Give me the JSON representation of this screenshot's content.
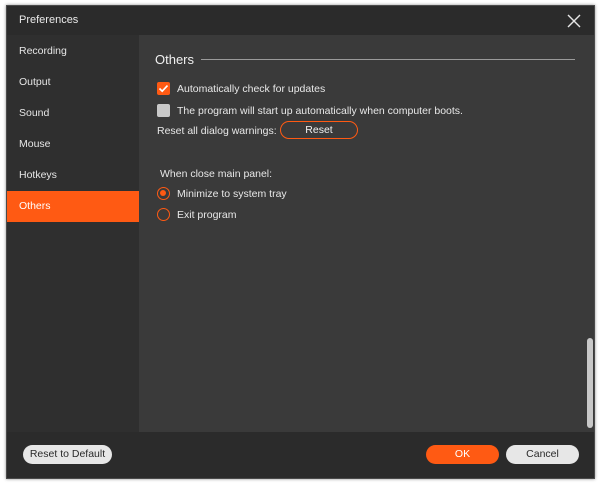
{
  "window": {
    "title": "Preferences",
    "close_icon": "close-icon"
  },
  "sidebar": {
    "items": [
      {
        "label": "Recording",
        "active": false
      },
      {
        "label": "Output",
        "active": false
      },
      {
        "label": "Sound",
        "active": false
      },
      {
        "label": "Mouse",
        "active": false
      },
      {
        "label": "Hotkeys",
        "active": false
      },
      {
        "label": "Others",
        "active": true
      }
    ]
  },
  "others": {
    "section_title": "Others",
    "check_updates": {
      "label": "Automatically check for updates",
      "checked": true
    },
    "auto_start": {
      "label": "The program will start up automatically when computer boots.",
      "checked": false
    },
    "reset_warnings": {
      "label": "Reset all dialog warnings:",
      "button": "Reset"
    },
    "close_panel": {
      "label": "When close main panel:",
      "options": [
        {
          "label": "Minimize to system tray",
          "selected": true
        },
        {
          "label": "Exit program",
          "selected": false
        }
      ]
    }
  },
  "footer": {
    "reset_default": "Reset to Default",
    "ok": "OK",
    "cancel": "Cancel"
  },
  "colors": {
    "accent": "#ff5a13",
    "background": "#2b2b2b",
    "panel": "#3a3a3a"
  }
}
